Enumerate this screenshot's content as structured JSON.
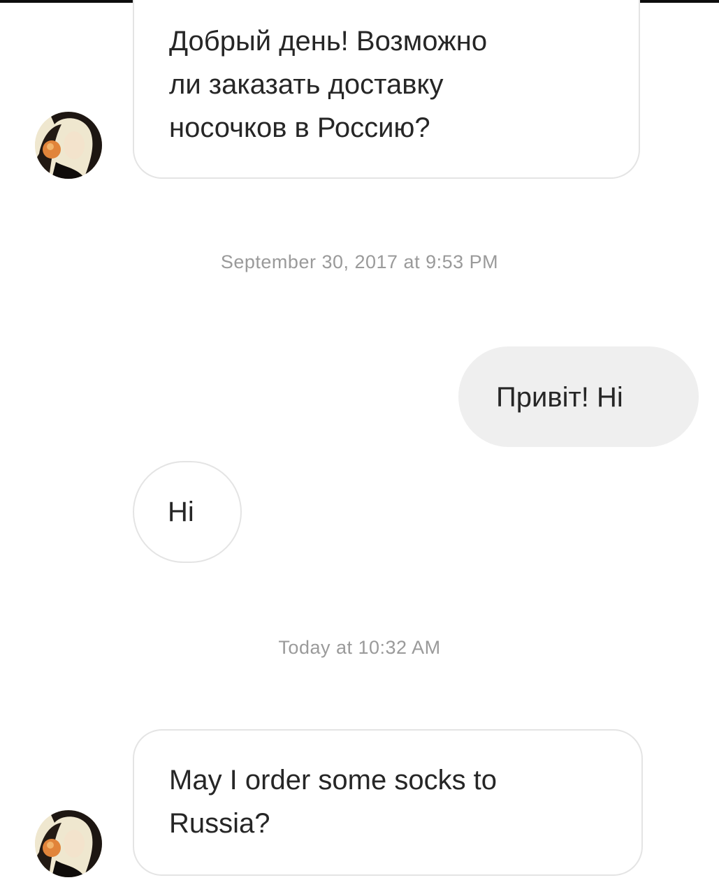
{
  "conversation": {
    "messages": [
      {
        "sender": "other",
        "text": "Добрый день! Возможно\nли заказать доставку\nносочков в Россию?"
      },
      {
        "sender": "me",
        "text": "Привіт! Hi"
      },
      {
        "sender": "other",
        "text": "Hi"
      },
      {
        "sender": "other",
        "text": "May I order some socks to\nRussia?"
      }
    ],
    "timestamps": [
      "September 30, 2017 at 9:53 PM",
      "Today at 10:32 AM"
    ]
  },
  "colors": {
    "incoming_bubble_border": "#e4e4e4",
    "outgoing_bubble_fill": "#efefef",
    "timestamp_text": "#9a9a9a"
  },
  "icons": {
    "avatar": "profile-photo-avatar"
  }
}
